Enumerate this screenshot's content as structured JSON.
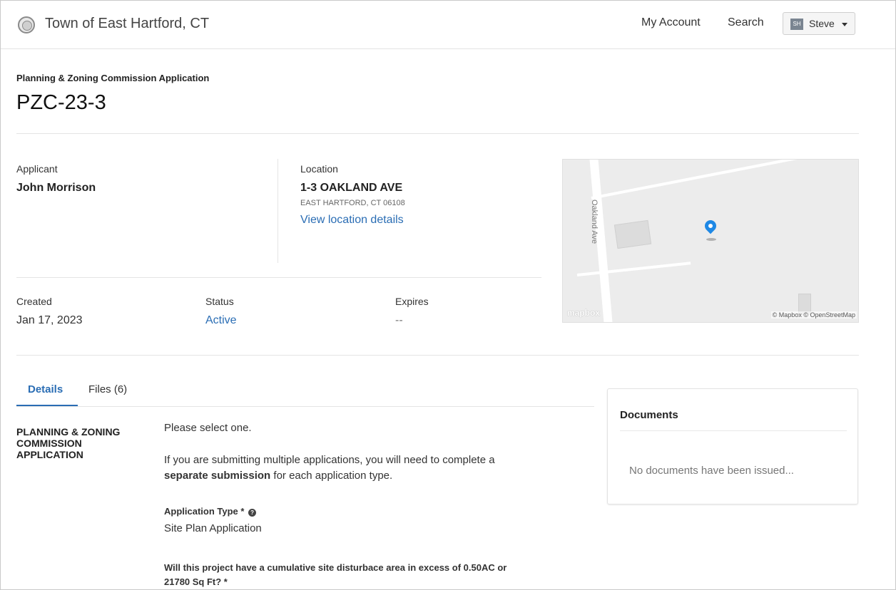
{
  "header": {
    "town": "Town of East Hartford, CT",
    "nav": {
      "account": "My Account",
      "search": "Search"
    },
    "user": {
      "initials": "SH",
      "name": "Steve"
    }
  },
  "record": {
    "type": "Planning & Zoning Commission Application",
    "id": "PZC-23-3"
  },
  "applicant": {
    "label": "Applicant",
    "name": "John Morrison"
  },
  "location": {
    "label": "Location",
    "address": "1-3 OAKLAND AVE",
    "city": "EAST HARTFORD, CT 06108",
    "details_link": "View location details"
  },
  "meta": {
    "created_label": "Created",
    "created_value": "Jan 17, 2023",
    "status_label": "Status",
    "status_value": "Active",
    "expires_label": "Expires",
    "expires_value": "--"
  },
  "map": {
    "street_label": "Oakland Ave",
    "logo": "mapbox",
    "attribution": "© Mapbox © OpenStreetMap"
  },
  "tabs": [
    {
      "label": "Details",
      "active": true
    },
    {
      "label": "Files (6)",
      "active": false
    }
  ],
  "form": {
    "section_title": "PLANNING & ZONING COMMISSION APPLICATION",
    "intro": "Please select one.",
    "multi_text_before": "If you are submitting multiple applications, you will need to complete a",
    "multi_bold": "separate submission",
    "multi_text_after": "for each application type.",
    "app_type_label": "Application Type *",
    "app_type_help_icon": "question-circle-icon",
    "app_type_value": "Site Plan Application",
    "question_line1": "Will this project have a cumulative site disturbace area in excess of 0.50AC or",
    "question_line2": "21780 Sq Ft? *"
  },
  "documents": {
    "title": "Documents",
    "empty": "No documents have been issued..."
  },
  "colors": {
    "link": "#2a6db4",
    "pin": "#1e88e5"
  }
}
